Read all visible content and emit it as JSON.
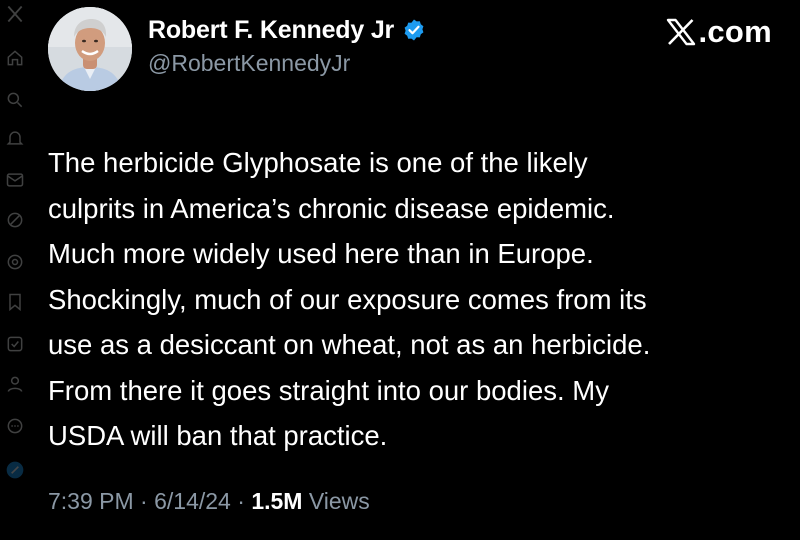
{
  "header": {
    "display_name": "Robert F. Kennedy Jr",
    "handle": "@RobertKennedyJr",
    "verified": true,
    "brand_text": ".com",
    "brand_full": "X.com"
  },
  "tweet": {
    "lines": [
      "The herbicide Glyphosate is one of the likely",
      "culprits in America’s chronic disease epidemic.",
      "Much more widely used here than in Europe.",
      "Shockingly, much of our exposure comes from its",
      "use as a desiccant on wheat, not as an herbicide.",
      "From there it goes straight into our bodies. My",
      "USDA will ban that practice."
    ]
  },
  "meta": {
    "time": "7:39 PM",
    "sep1": " · ",
    "date": "6/14/24",
    "sep2": " · ",
    "views_count": "1.5M",
    "views_label": " Views"
  },
  "colors": {
    "background": "#000000",
    "text_primary": "#ffffff",
    "text_secondary": "#8b98a5",
    "verified_blue": "#1d9bf0"
  },
  "icons": {
    "sidebar": [
      "x-logo-icon",
      "home-icon",
      "search-icon",
      "notifications-icon",
      "messages-icon",
      "grok-icon",
      "communities-icon",
      "bookmarks-icon",
      "premium-icon",
      "profile-icon",
      "more-icon",
      "post-icon"
    ]
  }
}
